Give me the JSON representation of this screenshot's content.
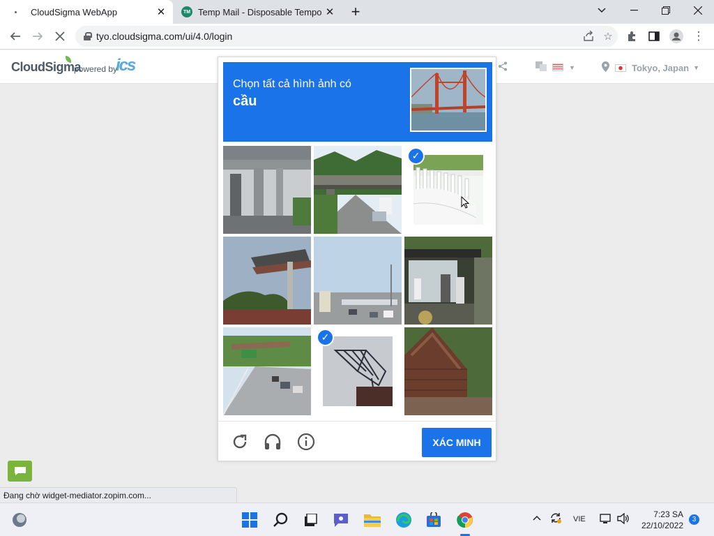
{
  "browser": {
    "tabs": [
      {
        "title": "CloudSigma WebApp",
        "active": true
      },
      {
        "title": "Temp Mail - Disposable Temporary",
        "active": false
      }
    ],
    "url": "tyo.cloudsigma.com/ui/4.0/login",
    "accent_color": "#1a73e8"
  },
  "site": {
    "logo_text": "CloudSigma",
    "powered_by": "powered by",
    "partner_logo": "ics",
    "location": "Tokyo, Japan"
  },
  "captcha": {
    "instruction": "Chọn tất cả hình ảnh có",
    "target": "cầu",
    "verify_label": "XÁC MINH",
    "tiles": [
      {
        "subject": "highway overpass pillars",
        "selected": false
      },
      {
        "subject": "road under bridge",
        "selected": false
      },
      {
        "subject": "white fence",
        "selected": true
      },
      {
        "subject": "bus shelter roof",
        "selected": false
      },
      {
        "subject": "city road",
        "selected": false
      },
      {
        "subject": "bus stop with people",
        "selected": false
      },
      {
        "subject": "highway with footbridge",
        "selected": false
      },
      {
        "subject": "steel truss structure",
        "selected": true
      },
      {
        "subject": "wooden roof",
        "selected": false
      }
    ],
    "footer_icons": [
      "reload-icon",
      "audio-icon",
      "info-icon"
    ]
  },
  "status_bar": {
    "text": "Đang chờ widget-mediator.zopim.com..."
  },
  "taskbar": {
    "language": "VIE",
    "time": "7:23 SA",
    "date": "22/10/2022",
    "notification_count": "3"
  }
}
